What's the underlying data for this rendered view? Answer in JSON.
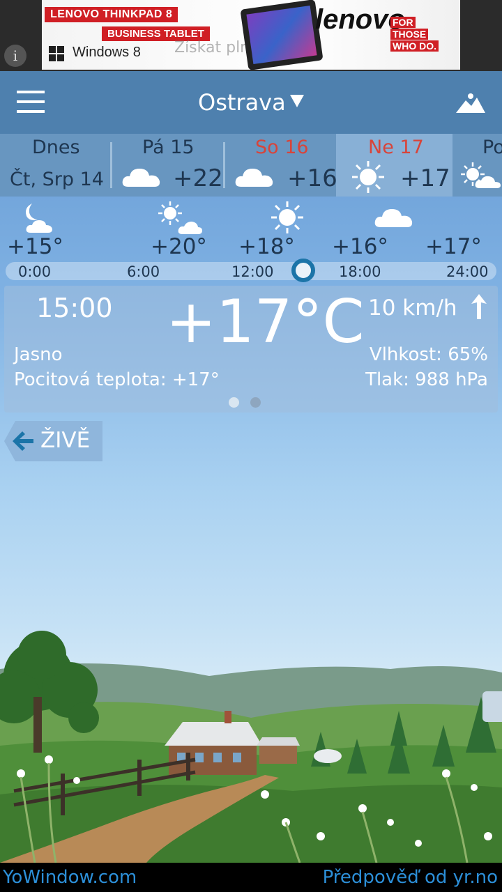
{
  "ad": {
    "headline": "LENOVO THINKPAD 8",
    "subline": "BUSINESS TABLET",
    "os_label": "Windows 8",
    "brand": "lenovo",
    "slogan": [
      "FOR",
      "THOSE",
      "WHO DO."
    ],
    "ghost_text": "Získat plnou verzi",
    "info_icon": "info-icon"
  },
  "header": {
    "menu_icon": "hamburger-menu-icon",
    "city": "Ostrava",
    "city_dropdown_icon": "triangle-down-icon",
    "landscape_icon": "landscape-icon"
  },
  "days": [
    {
      "name": "Dnes",
      "date": "Čt, Srp 14",
      "temp": "",
      "icon": "",
      "weekend": false,
      "selected": false
    },
    {
      "name": "Pá 15",
      "date": "",
      "temp": "+22",
      "icon": "cloud-icon",
      "weekend": false,
      "selected": false
    },
    {
      "name": "So 16",
      "date": "",
      "temp": "+16",
      "icon": "cloud-icon",
      "weekend": true,
      "selected": false
    },
    {
      "name": "Ne 17",
      "date": "",
      "temp": "+17",
      "icon": "sun-icon",
      "weekend": true,
      "selected": true
    },
    {
      "name": "Po",
      "date": "",
      "temp": "",
      "icon": "sun-cloud-icon",
      "weekend": false,
      "selected": false
    }
  ],
  "hourly": {
    "items": [
      {
        "temp": "+15°",
        "icon": "moon-cloud-icon"
      },
      {
        "temp": "+20°",
        "icon": "sun-cloud-icon"
      },
      {
        "temp": "+18°",
        "icon": "sun-icon"
      },
      {
        "temp": "+16°",
        "icon": "cloud-icon"
      },
      {
        "temp": "+17°",
        "icon": ""
      }
    ],
    "times": [
      "0:00",
      "6:00",
      "12:00",
      "18:00",
      "24:00"
    ],
    "slider_value": "15:00"
  },
  "current": {
    "time": "15:00",
    "temperature": "+17°C",
    "wind": "10 km/h",
    "wind_icon": "wind-arrow-icon",
    "condition": "Jasno",
    "feels_like": "Pocitová teplota: +17°",
    "humidity": "Vlhkost: 65%",
    "pressure": "Tlak: 988 hPa",
    "page_count": 2,
    "active_page": 1
  },
  "live_button": {
    "label": "ŽIVĚ",
    "icon": "arrow-left-icon"
  },
  "footer": {
    "left": "YoWindow.com",
    "right": "Předpověď od yr.no"
  },
  "colors": {
    "header_bg": "#4e80ae",
    "days_bg": "#6896c0",
    "selected_day_bg": "#88b0d6",
    "weekend_text": "#d8443a",
    "dark_text": "#1e3650",
    "footer_link": "#2c8fd8",
    "slider_knob": "#1b74a8"
  }
}
